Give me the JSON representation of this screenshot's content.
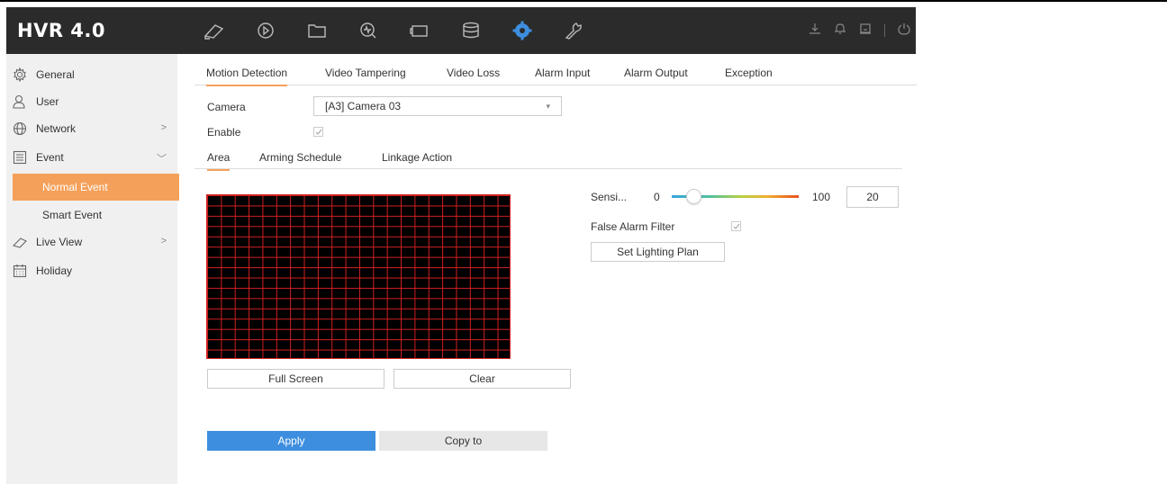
{
  "app": {
    "title": "HVR 4.0"
  },
  "topbar": {
    "icons": [
      "live-view-icon",
      "playback-icon",
      "file-management-icon",
      "smart-analysis-icon",
      "manual-icon",
      "storage-icon",
      "configuration-icon",
      "maintenance-icon"
    ],
    "active_icon": "configuration-icon",
    "accent": "#3e8edf"
  },
  "sidebar": {
    "items": [
      {
        "label": "General",
        "icon": "gear-icon"
      },
      {
        "label": "User",
        "icon": "user-icon"
      },
      {
        "label": "Network",
        "icon": "globe-icon",
        "arrow": ">"
      },
      {
        "label": "Event",
        "icon": "list-icon",
        "arrow": "﹀"
      },
      {
        "label": "Normal Event"
      },
      {
        "label": "Smart Event"
      },
      {
        "label": "Live View",
        "icon": "camera-icon",
        "arrow": ">"
      },
      {
        "label": "Holiday",
        "icon": "calendar-icon"
      }
    ],
    "active_color": "#f5a05a"
  },
  "tabs": [
    "Motion Detection",
    "Video Tampering",
    "Video Loss",
    "Alarm Input",
    "Alarm Output",
    "Exception"
  ],
  "form": {
    "camera_label": "Camera",
    "camera_value": "[A3] Camera 03",
    "enable_label": "Enable",
    "enable_checked": true
  },
  "subtabs": [
    "Area",
    "Arming Schedule",
    "Linkage Action"
  ],
  "settings": {
    "sensitivity_label": "Sensi...",
    "slider_min": "0",
    "slider_max": "100",
    "sensitivity_value": "20",
    "false_alarm_label": "False Alarm Filter",
    "false_alarm_checked": true,
    "lighting_button": "Set Lighting Plan"
  },
  "area_buttons": {
    "full_screen": "Full Screen",
    "clear": "Clear"
  },
  "footer": {
    "apply": "Apply",
    "copy_to": "Copy to"
  }
}
